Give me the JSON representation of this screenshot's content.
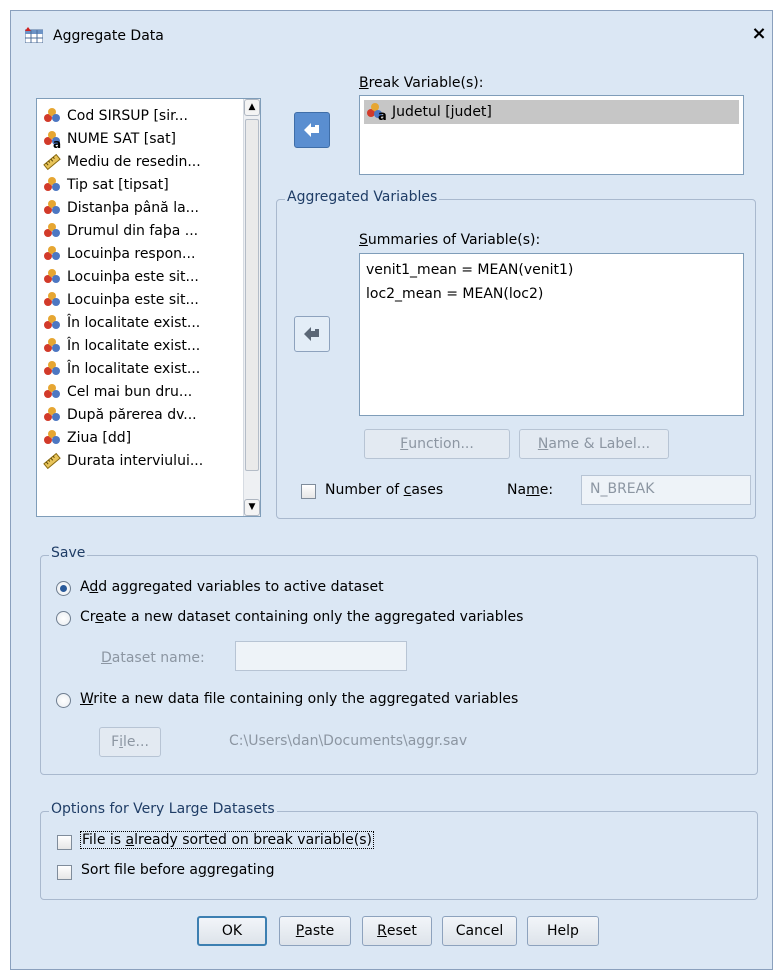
{
  "window": {
    "title": "Aggregate Data",
    "close": "×"
  },
  "variables": [
    {
      "label": "Cod SIRSUP [sir...",
      "icon": "nominal-icon"
    },
    {
      "label": "NUME SAT [sat]",
      "icon": "nominal-string-icon"
    },
    {
      "label": "Mediu de resedin...",
      "icon": "scale-ruler-icon"
    },
    {
      "label": "Tip sat [tipsat]",
      "icon": "nominal-icon"
    },
    {
      "label": "Distanþa până la...",
      "icon": "nominal-icon"
    },
    {
      "label": "Drumul din faþa ...",
      "icon": "nominal-icon"
    },
    {
      "label": "Locuinþa respon...",
      "icon": "nominal-icon"
    },
    {
      "label": "Locuinþa este sit...",
      "icon": "nominal-icon"
    },
    {
      "label": "Locuinþa este sit...",
      "icon": "nominal-icon"
    },
    {
      "label": "În localitate exist...",
      "icon": "nominal-icon"
    },
    {
      "label": "În localitate exist...",
      "icon": "nominal-icon"
    },
    {
      "label": "În localitate exist...",
      "icon": "nominal-icon"
    },
    {
      "label": "Cel mai bun dru...",
      "icon": "nominal-icon"
    },
    {
      "label": "După părerea dv...",
      "icon": "nominal-icon"
    },
    {
      "label": "Ziua [dd]",
      "icon": "nominal-icon"
    },
    {
      "label": "Durata interviului...",
      "icon": "scale-ruler-icon"
    }
  ],
  "break": {
    "label_prefix": "",
    "label_u": "B",
    "label_rest": "reak Variable(s):",
    "items": [
      "Judetul [judet]"
    ]
  },
  "aggregated": {
    "legend": "Aggregated Variables",
    "summaries_u": "S",
    "summaries_rest": "ummaries of Variable(s):",
    "items": [
      "venit1_mean = MEAN(venit1)",
      "loc2_mean = MEAN(loc2)"
    ],
    "function_u": "F",
    "function_rest": "unction...",
    "namelabel_u": "N",
    "namelabel_rest": "ame & Label...",
    "num_cases_pre": "Number of ",
    "num_cases_u": "c",
    "num_cases_post": "ases",
    "name_pre": "Na",
    "name_u": "m",
    "name_post": "e:",
    "name_value": "N_BREAK"
  },
  "save": {
    "legend": "Save",
    "opt1_pre": "A",
    "opt1_u": "d",
    "opt1_post": "d aggregated variables to active dataset",
    "opt2_pre": "Cr",
    "opt2_u": "e",
    "opt2_post": "ate a new dataset containing only the aggregated variables",
    "dataset_u": "D",
    "dataset_rest": "ataset name:",
    "opt3_u": "W",
    "opt3_post": "rite a new data file containing only the aggregated variables",
    "file_pre": "F",
    "file_u": "i",
    "file_post": "le...",
    "file_path": "C:\\Users\\dan\\Documents\\aggr.sav"
  },
  "options": {
    "legend": "Options for Very Large Datasets",
    "sorted_pre": "File is ",
    "sorted_u": "a",
    "sorted_post": "lready sorted on break variable(s)",
    "sort_pre": "Sort file before a",
    "sort_u": "g",
    "sort_post": "gregating"
  },
  "buttons": {
    "ok": "OK",
    "paste_u": "P",
    "paste_rest": "aste",
    "reset_u": "R",
    "reset_rest": "eset",
    "cancel": "Cancel",
    "help": "Help"
  },
  "colors": {
    "dialog_bg": "#dbe7f4",
    "accent": "#5a8ed0",
    "group_title": "#1f3d66"
  }
}
